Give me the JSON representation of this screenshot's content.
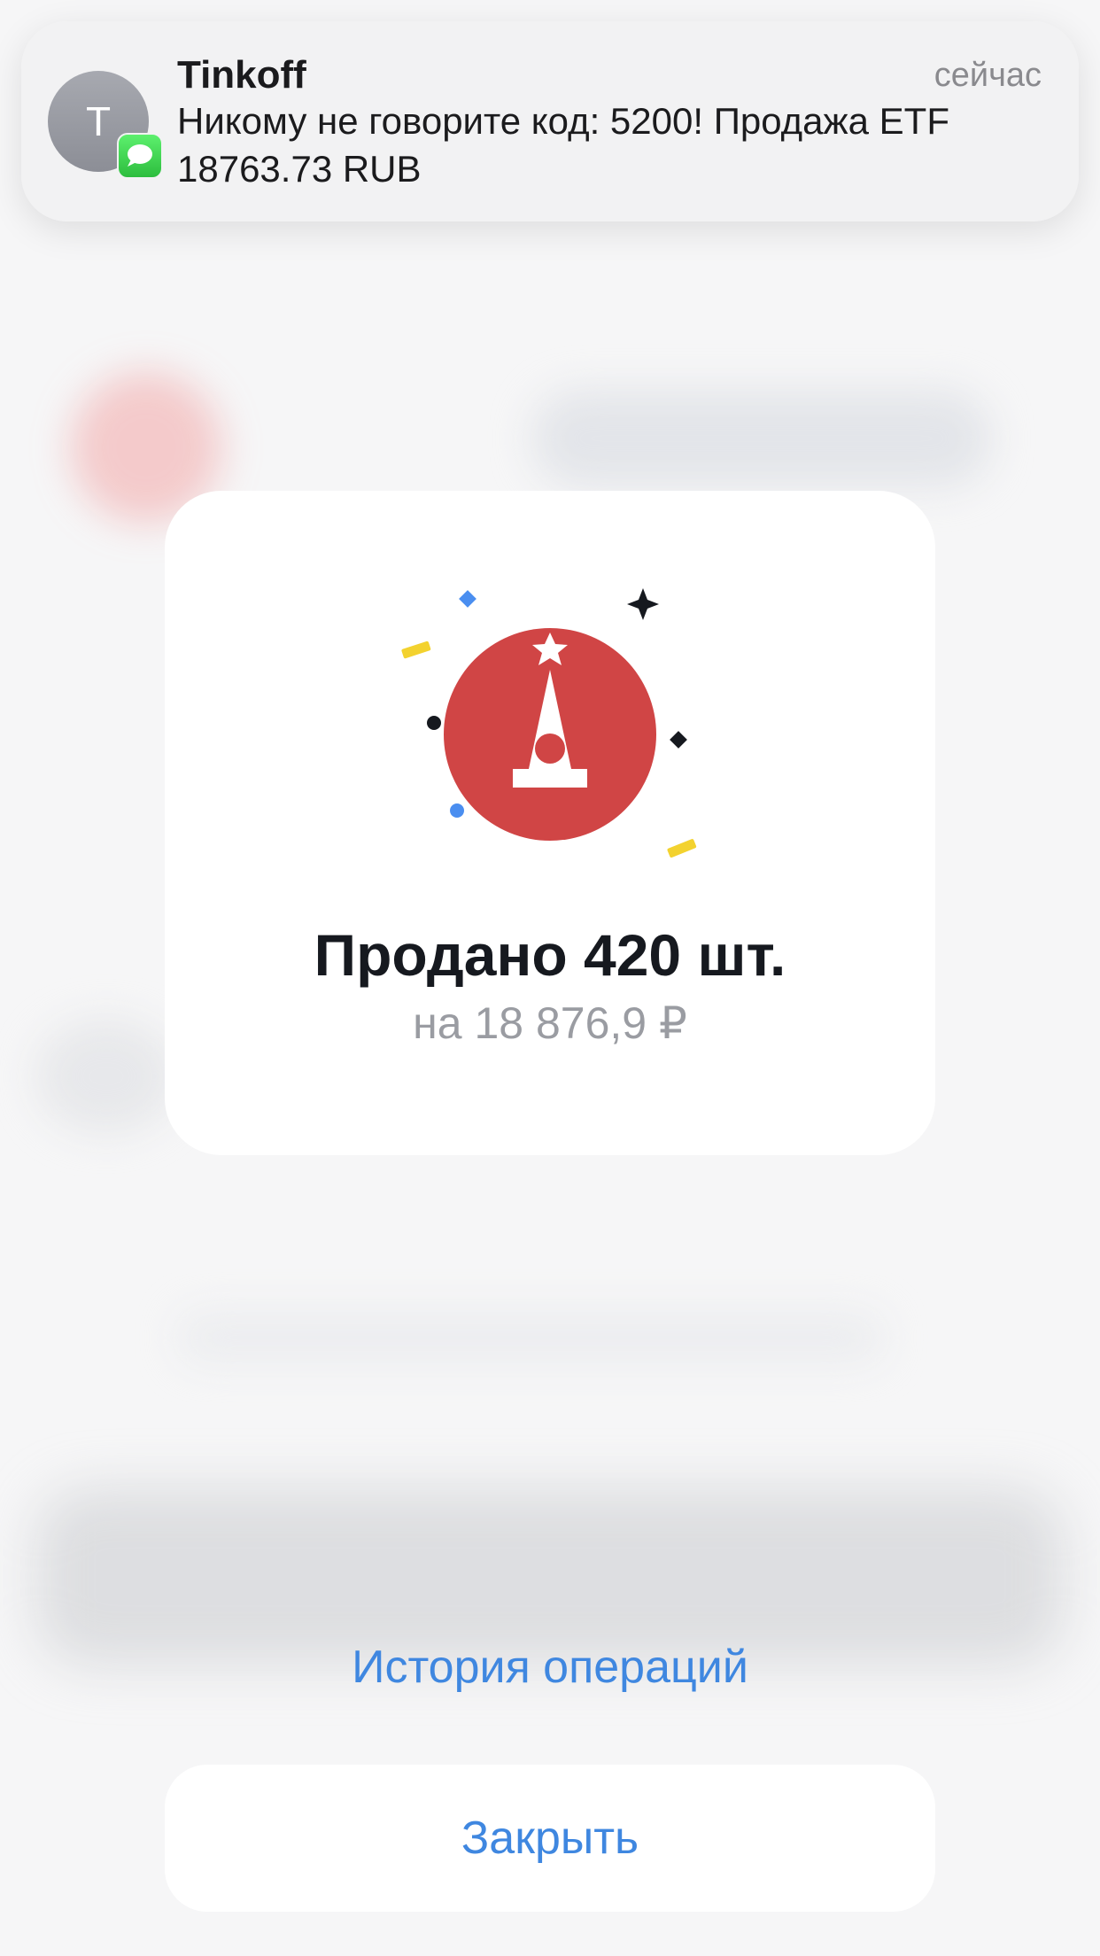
{
  "notification": {
    "avatar_letter": "T",
    "app_name": "Tinkoff",
    "time": "сейчас",
    "message": "Никому не говорите код: 5200! Продажа ETF 18763.73 RUB"
  },
  "result": {
    "title": "Продано 420 шт.",
    "subtitle": "на 18 876,9 ₽",
    "icon": "kremlin-tower-icon",
    "accent_color": "#d04545"
  },
  "actions": {
    "history_label": "История операций",
    "close_label": "Закрыть",
    "link_color": "#3f87e0"
  }
}
